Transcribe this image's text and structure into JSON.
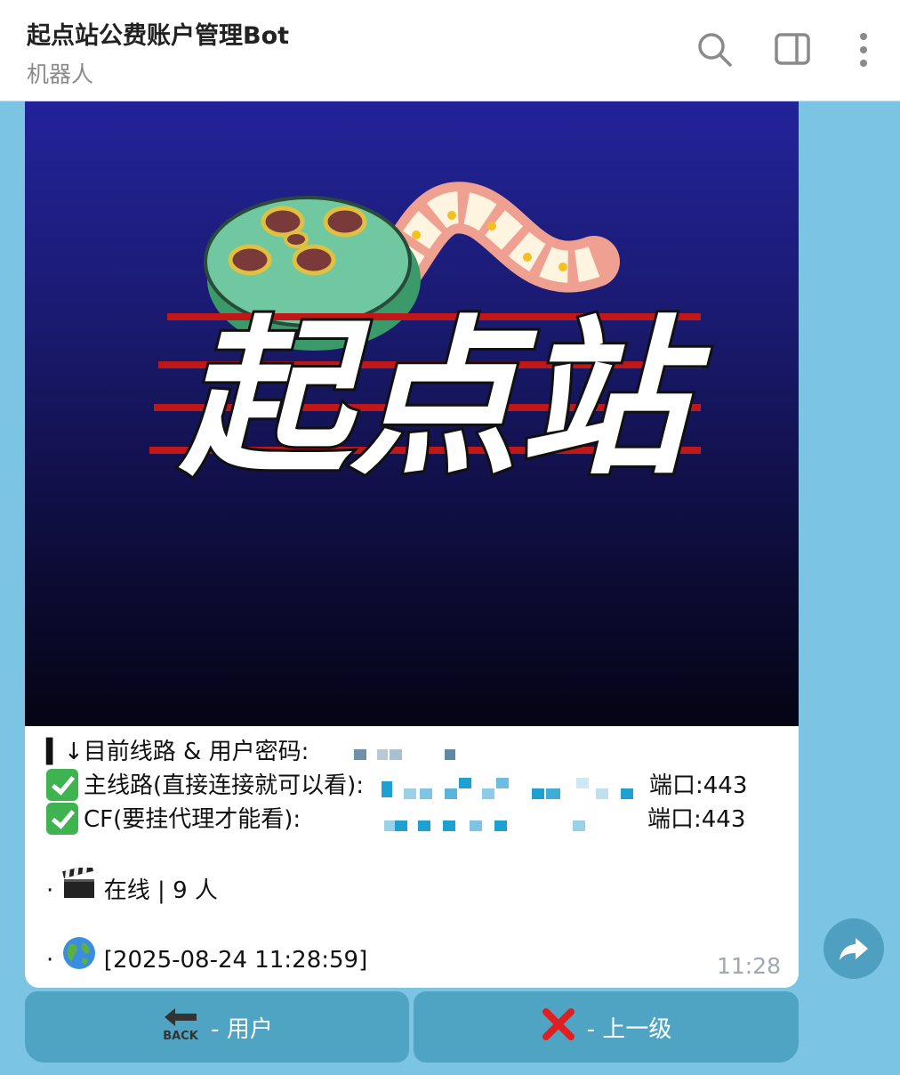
{
  "header": {
    "title": "起点站公费账户管理Bot",
    "subtitle": "机器人"
  },
  "banner": {
    "logo_text": "起点站",
    "icons": [
      "film-reel-icon",
      "film-strip-icon"
    ]
  },
  "message": {
    "line1_label": "▍↓目前线路 & 用户密码:",
    "line2_label": "主线路(直接连接就可以看):",
    "line2_port": "端口:443",
    "line3_label": "CF(要挂代理才能看):",
    "line3_port": "端口:443",
    "online_bullet": "·",
    "online_text": "在线 | 9 人",
    "time_bullet": "·",
    "time_text": "[2025-08-24 11:28:59]",
    "sent_time": "11:28"
  },
  "keyboard": {
    "back_label": "- 用户",
    "back_icon_text": "BACK",
    "up_label": "- 上一级"
  },
  "colors": {
    "chat_bg": "#7cc4e3",
    "button_bg": "#4fa4c4",
    "check_green": "#3fb34f",
    "cross_red": "#e02020"
  }
}
